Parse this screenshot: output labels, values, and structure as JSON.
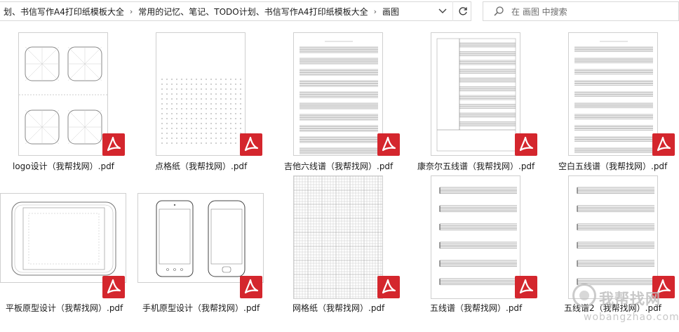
{
  "breadcrumb": {
    "items": [
      "划、书信写作A4打印纸模板大全",
      "常用的记忆、笔记、TODO计划、书信写作A4打印纸模板大全",
      "画图"
    ],
    "separator": "›",
    "dropdown_icon": "chevron-down-icon",
    "refresh_icon": "refresh-icon"
  },
  "search": {
    "placeholder": "在 画图 中搜索",
    "icon": "search-icon"
  },
  "files": [
    {
      "name": "logo设计（我帮找网）.pdf",
      "thumb": "logo"
    },
    {
      "name": "点格纸（我帮找网）.pdf",
      "thumb": "dots"
    },
    {
      "name": "吉他六线谱（我帮找网）.pdf",
      "thumb": "guitar"
    },
    {
      "name": "康奈尔五线谱（我帮找网）.pdf",
      "thumb": "cornell"
    },
    {
      "name": "空白五线谱（我帮找网）.pdf",
      "thumb": "blankstaff"
    },
    {
      "name": "平板原型设计（我帮找网）.pdf",
      "thumb": "tablet"
    },
    {
      "name": "手机原型设计（我帮找网）.pdf",
      "thumb": "phone"
    },
    {
      "name": "网格纸（我帮找网）.pdf",
      "thumb": "grid"
    },
    {
      "name": "五线谱（我帮找网）.pdf",
      "thumb": "staff"
    },
    {
      "name": "五线谱2（我帮找网）.pdf",
      "thumb": "staff2"
    }
  ],
  "watermark": {
    "text": "我帮找网",
    "url_text": "wobangzhao.com"
  },
  "colors": {
    "pdf_badge": "#d4262d",
    "border": "#cfcfcf"
  }
}
